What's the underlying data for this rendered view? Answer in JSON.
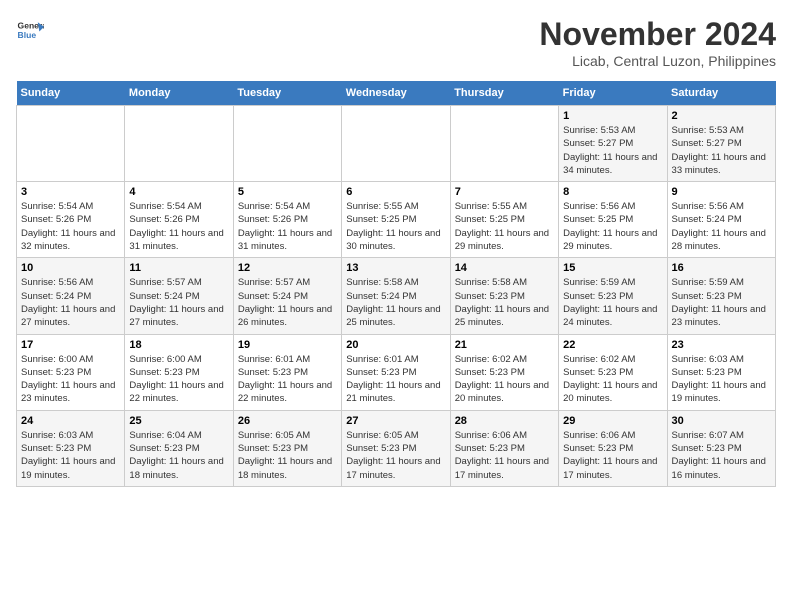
{
  "header": {
    "logo_line1": "General",
    "logo_line2": "Blue",
    "title": "November 2024",
    "subtitle": "Licab, Central Luzon, Philippines"
  },
  "weekdays": [
    "Sunday",
    "Monday",
    "Tuesday",
    "Wednesday",
    "Thursday",
    "Friday",
    "Saturday"
  ],
  "weeks": [
    [
      {
        "num": "",
        "info": ""
      },
      {
        "num": "",
        "info": ""
      },
      {
        "num": "",
        "info": ""
      },
      {
        "num": "",
        "info": ""
      },
      {
        "num": "",
        "info": ""
      },
      {
        "num": "1",
        "info": "Sunrise: 5:53 AM\nSunset: 5:27 PM\nDaylight: 11 hours and 34 minutes."
      },
      {
        "num": "2",
        "info": "Sunrise: 5:53 AM\nSunset: 5:27 PM\nDaylight: 11 hours and 33 minutes."
      }
    ],
    [
      {
        "num": "3",
        "info": "Sunrise: 5:54 AM\nSunset: 5:26 PM\nDaylight: 11 hours and 32 minutes."
      },
      {
        "num": "4",
        "info": "Sunrise: 5:54 AM\nSunset: 5:26 PM\nDaylight: 11 hours and 31 minutes."
      },
      {
        "num": "5",
        "info": "Sunrise: 5:54 AM\nSunset: 5:26 PM\nDaylight: 11 hours and 31 minutes."
      },
      {
        "num": "6",
        "info": "Sunrise: 5:55 AM\nSunset: 5:25 PM\nDaylight: 11 hours and 30 minutes."
      },
      {
        "num": "7",
        "info": "Sunrise: 5:55 AM\nSunset: 5:25 PM\nDaylight: 11 hours and 29 minutes."
      },
      {
        "num": "8",
        "info": "Sunrise: 5:56 AM\nSunset: 5:25 PM\nDaylight: 11 hours and 29 minutes."
      },
      {
        "num": "9",
        "info": "Sunrise: 5:56 AM\nSunset: 5:24 PM\nDaylight: 11 hours and 28 minutes."
      }
    ],
    [
      {
        "num": "10",
        "info": "Sunrise: 5:56 AM\nSunset: 5:24 PM\nDaylight: 11 hours and 27 minutes."
      },
      {
        "num": "11",
        "info": "Sunrise: 5:57 AM\nSunset: 5:24 PM\nDaylight: 11 hours and 27 minutes."
      },
      {
        "num": "12",
        "info": "Sunrise: 5:57 AM\nSunset: 5:24 PM\nDaylight: 11 hours and 26 minutes."
      },
      {
        "num": "13",
        "info": "Sunrise: 5:58 AM\nSunset: 5:24 PM\nDaylight: 11 hours and 25 minutes."
      },
      {
        "num": "14",
        "info": "Sunrise: 5:58 AM\nSunset: 5:23 PM\nDaylight: 11 hours and 25 minutes."
      },
      {
        "num": "15",
        "info": "Sunrise: 5:59 AM\nSunset: 5:23 PM\nDaylight: 11 hours and 24 minutes."
      },
      {
        "num": "16",
        "info": "Sunrise: 5:59 AM\nSunset: 5:23 PM\nDaylight: 11 hours and 23 minutes."
      }
    ],
    [
      {
        "num": "17",
        "info": "Sunrise: 6:00 AM\nSunset: 5:23 PM\nDaylight: 11 hours and 23 minutes."
      },
      {
        "num": "18",
        "info": "Sunrise: 6:00 AM\nSunset: 5:23 PM\nDaylight: 11 hours and 22 minutes."
      },
      {
        "num": "19",
        "info": "Sunrise: 6:01 AM\nSunset: 5:23 PM\nDaylight: 11 hours and 22 minutes."
      },
      {
        "num": "20",
        "info": "Sunrise: 6:01 AM\nSunset: 5:23 PM\nDaylight: 11 hours and 21 minutes."
      },
      {
        "num": "21",
        "info": "Sunrise: 6:02 AM\nSunset: 5:23 PM\nDaylight: 11 hours and 20 minutes."
      },
      {
        "num": "22",
        "info": "Sunrise: 6:02 AM\nSunset: 5:23 PM\nDaylight: 11 hours and 20 minutes."
      },
      {
        "num": "23",
        "info": "Sunrise: 6:03 AM\nSunset: 5:23 PM\nDaylight: 11 hours and 19 minutes."
      }
    ],
    [
      {
        "num": "24",
        "info": "Sunrise: 6:03 AM\nSunset: 5:23 PM\nDaylight: 11 hours and 19 minutes."
      },
      {
        "num": "25",
        "info": "Sunrise: 6:04 AM\nSunset: 5:23 PM\nDaylight: 11 hours and 18 minutes."
      },
      {
        "num": "26",
        "info": "Sunrise: 6:05 AM\nSunset: 5:23 PM\nDaylight: 11 hours and 18 minutes."
      },
      {
        "num": "27",
        "info": "Sunrise: 6:05 AM\nSunset: 5:23 PM\nDaylight: 11 hours and 17 minutes."
      },
      {
        "num": "28",
        "info": "Sunrise: 6:06 AM\nSunset: 5:23 PM\nDaylight: 11 hours and 17 minutes."
      },
      {
        "num": "29",
        "info": "Sunrise: 6:06 AM\nSunset: 5:23 PM\nDaylight: 11 hours and 17 minutes."
      },
      {
        "num": "30",
        "info": "Sunrise: 6:07 AM\nSunset: 5:23 PM\nDaylight: 11 hours and 16 minutes."
      }
    ]
  ]
}
